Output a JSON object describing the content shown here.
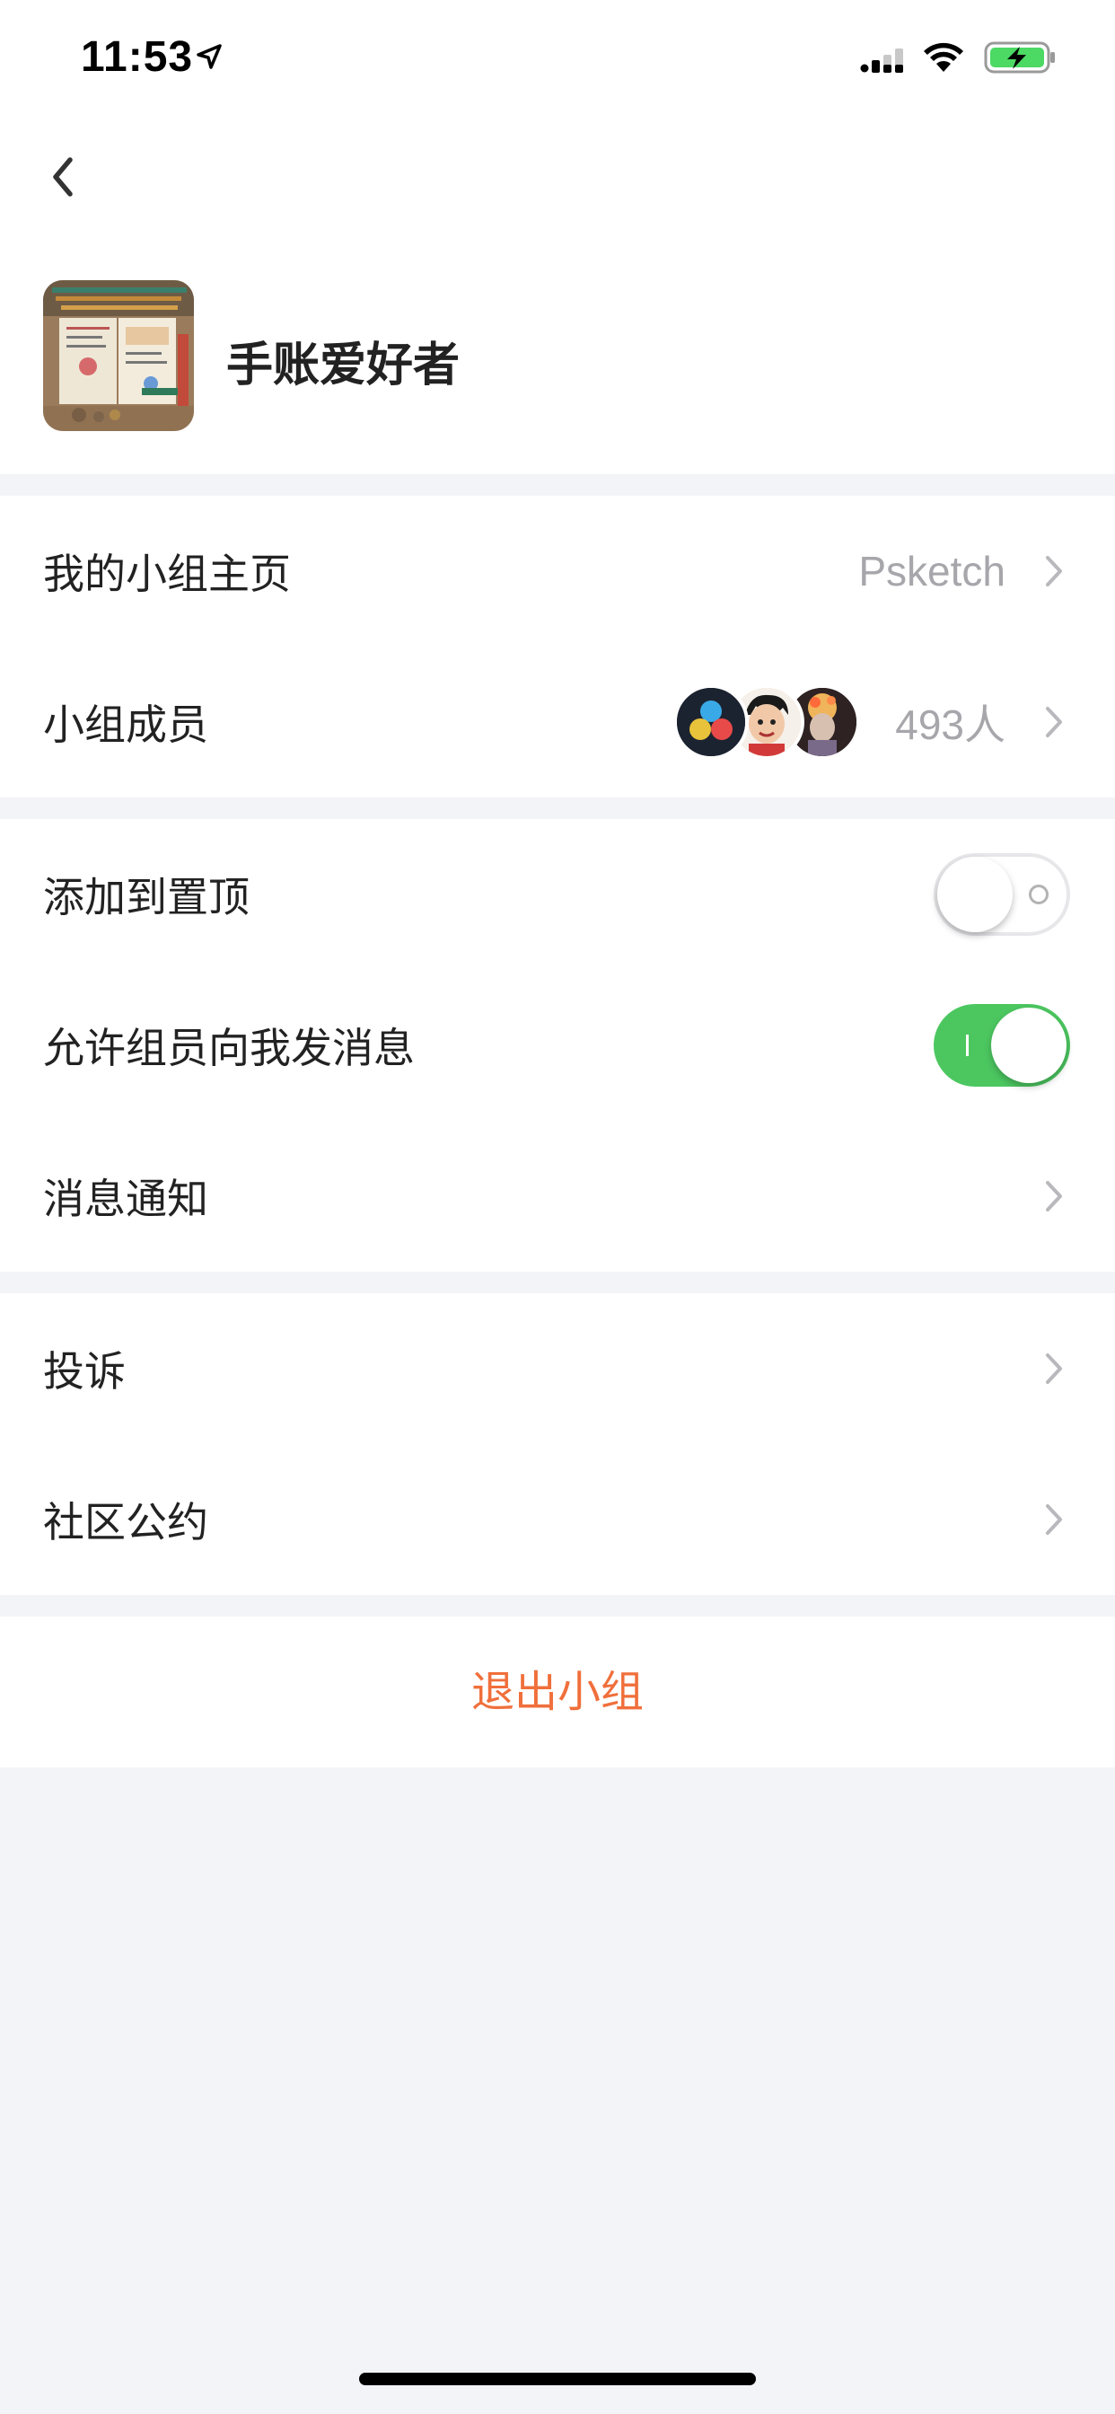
{
  "status_bar": {
    "time": "11:53",
    "icons": [
      "location-arrow-icon",
      "cellular-signal-icon",
      "wifi-icon",
      "battery-charging-icon"
    ]
  },
  "header": {
    "back_icon": "chevron-left-icon",
    "group_name": "手账爱好者"
  },
  "section_group": {
    "homepage_label": "我的小组主页",
    "homepage_value": "Psketch",
    "members_label": "小组成员",
    "members_count": "493人"
  },
  "section_settings": {
    "pin_label": "添加到置顶",
    "pin_enabled": false,
    "allow_messages_label": "允许组员向我发消息",
    "allow_messages_enabled": true,
    "notifications_label": "消息通知"
  },
  "section_misc": {
    "report_label": "投诉",
    "convention_label": "社区公约"
  },
  "leave": {
    "label": "退出小组"
  },
  "colors": {
    "background": "#f3f4f8",
    "accent_green": "#4cc760",
    "danger_orange": "#f06f3b",
    "secondary_text": "#a6a6ab"
  }
}
